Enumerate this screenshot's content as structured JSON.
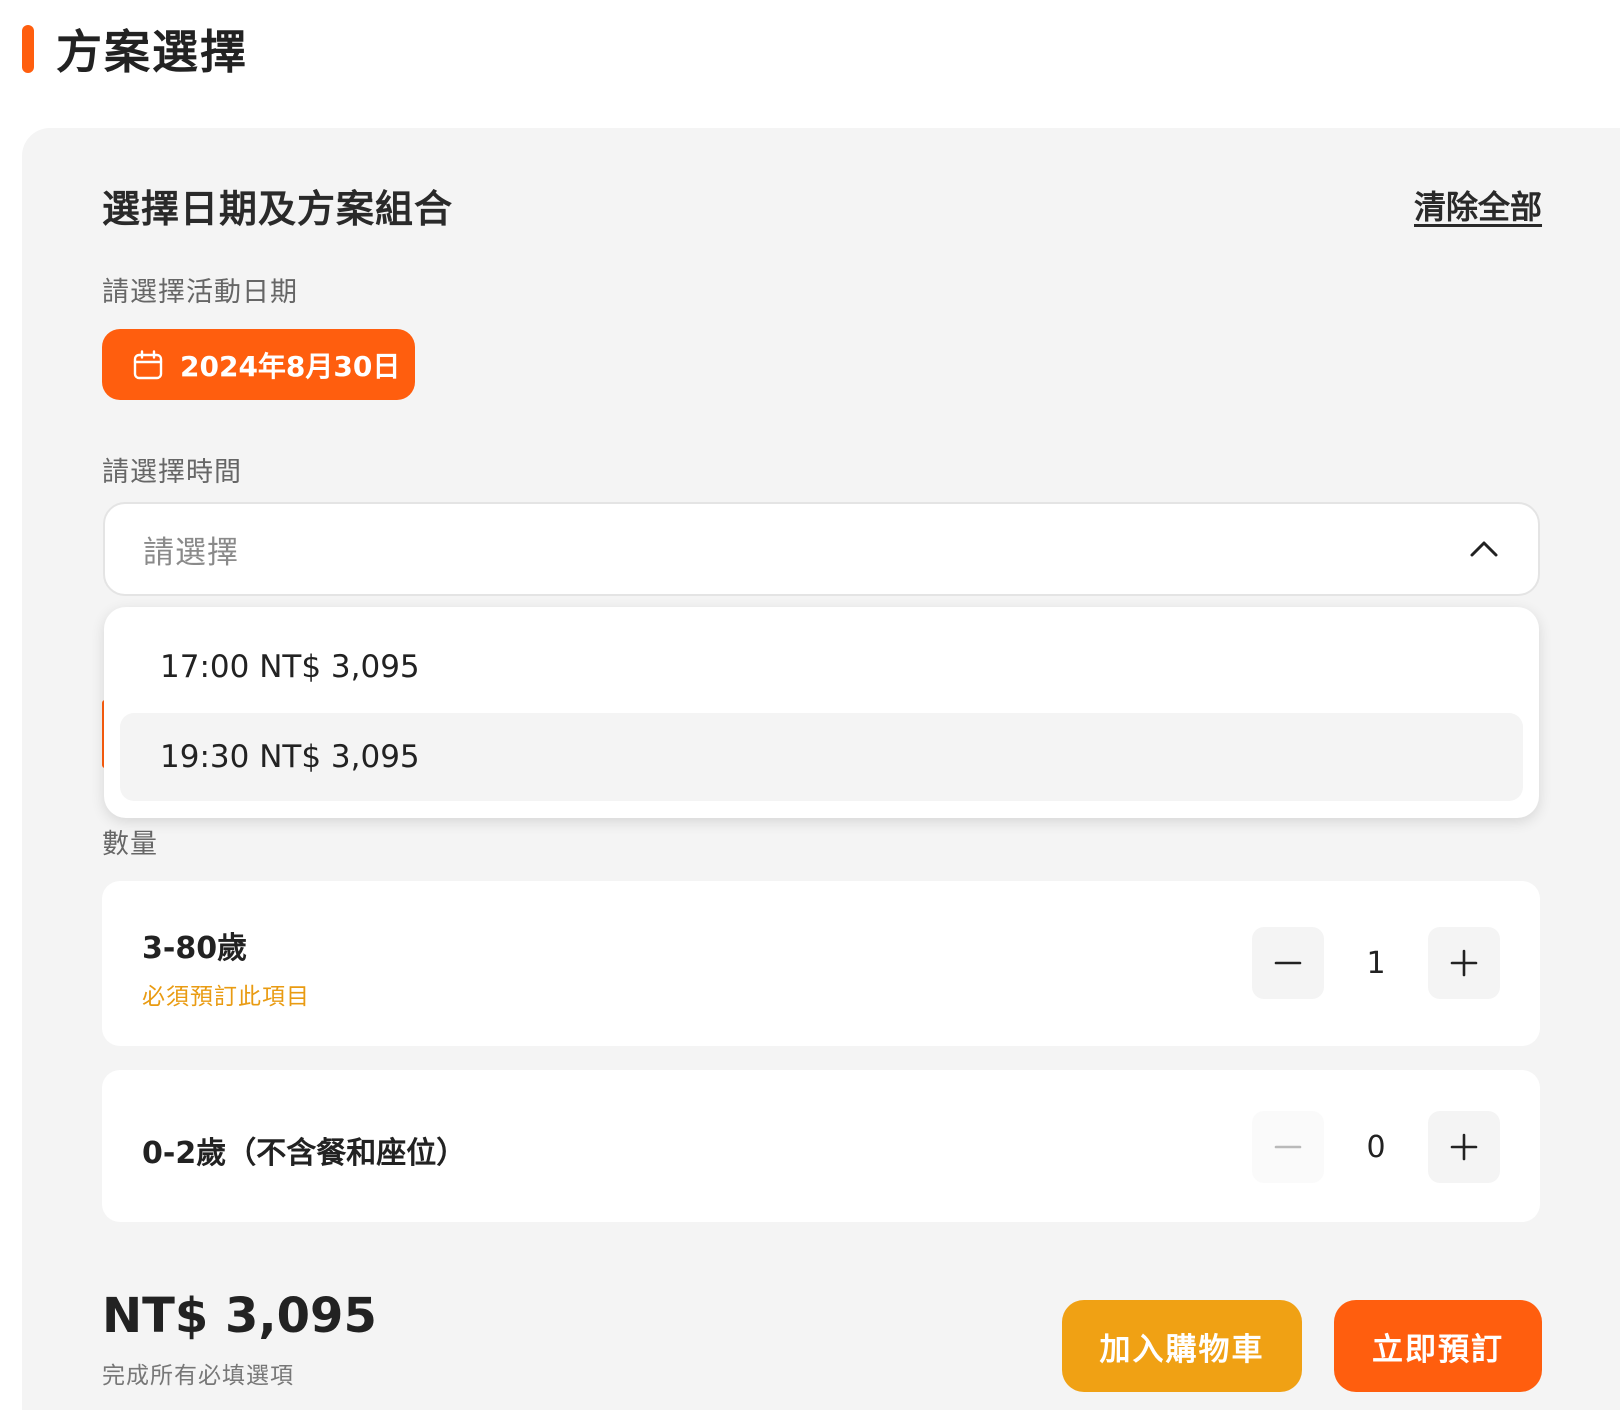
{
  "section": {
    "title": "方案選擇"
  },
  "card": {
    "title": "選擇日期及方案組合",
    "clear_all": "清除全部"
  },
  "date": {
    "label": "請選擇活動日期",
    "value": "2024年8月30日",
    "icon": "calendar-icon"
  },
  "time": {
    "label": "請選擇時間",
    "placeholder": "請選擇",
    "expanded": true,
    "icon": "chevron-up-icon",
    "options": [
      {
        "label": "17:00 NT$ 3,095",
        "highlighted": false
      },
      {
        "label": "19:30 NT$ 3,095",
        "highlighted": true
      }
    ]
  },
  "quantity": {
    "label": "數量",
    "rows": [
      {
        "name": "3-80歲",
        "note": "必須預訂此項目",
        "value": "1",
        "minus_disabled": false
      },
      {
        "name": "0-2歲（不含餐和座位）",
        "note": "",
        "value": "0",
        "minus_disabled": true
      }
    ]
  },
  "footer": {
    "total": "NT$ 3,095",
    "note": "完成所有必填選項",
    "add_to_cart": "加入購物車",
    "book_now": "立即預訂"
  },
  "colors": {
    "accent": "#ff5e0e",
    "secondary": "#f0a114",
    "note": "#e99b12",
    "card_bg": "#f4f4f4"
  }
}
